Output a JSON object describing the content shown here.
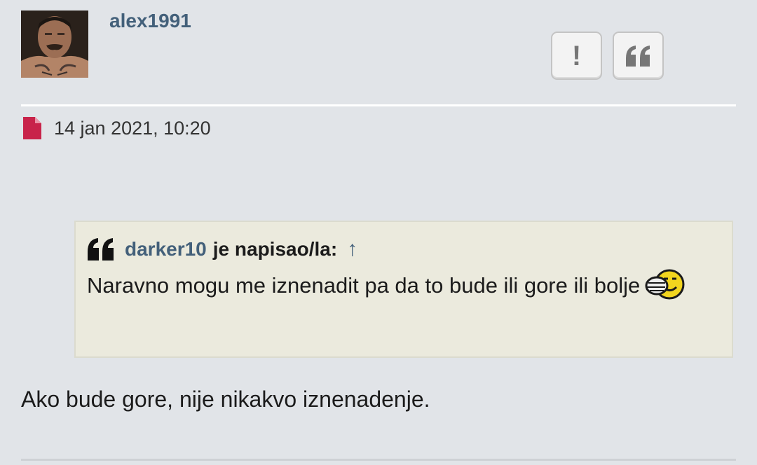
{
  "post": {
    "author": "alex1991",
    "avatar_icon": "user-avatar-photo",
    "report_label": "!",
    "quote_icon": "quote-icon",
    "date": "14 jan 2021, 10:20",
    "date_icon": "file-icon",
    "quote": {
      "author": "darker10",
      "wrote_label": "je napisao/la:",
      "jump_label": "↑",
      "text": "Naravno mogu me iznenadit pa da to bude ili gore ili bolje"
    },
    "body": "Ako bude gore, nije nikakvo iznenadenje."
  },
  "colors": {
    "background": "#e1e4e8",
    "accent": "#43607a",
    "quote_bg": "#ebeadd",
    "file_icon": "#c8234a"
  }
}
